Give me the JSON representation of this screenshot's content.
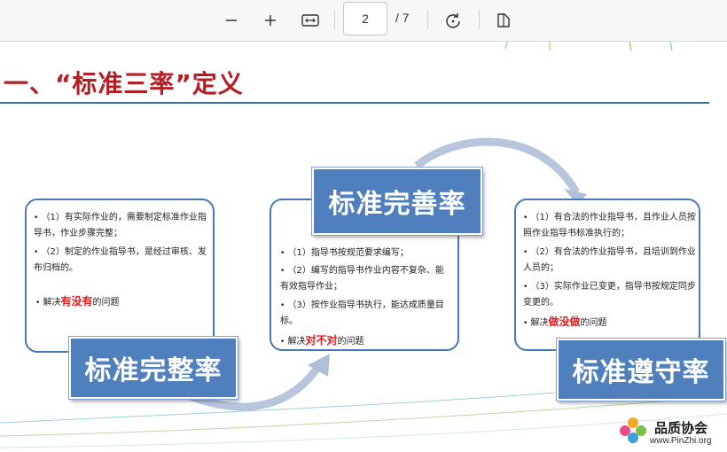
{
  "toolbar": {
    "zoom_out_icon": "minus-icon",
    "zoom_in_icon": "plus-icon",
    "fit_icon": "fit-width-icon",
    "page_current": "2",
    "page_total": "/ 7",
    "rotate_icon": "rotate-icon",
    "view_icon": "page-view-icon"
  },
  "slide": {
    "title": "一、“标准三率”定义",
    "cards": [
      {
        "label": "标准完整率",
        "bullets": [
          "（1）有实际作业的，需要制定标准作业指导书，作业步骤完整；",
          "（2）制定的作业指导书，是经过审核、发布归档的。"
        ],
        "solve_prefix": "解决",
        "solve_key": "有没有",
        "solve_suffix": "的问题"
      },
      {
        "label": "标准完善率",
        "bullets": [
          "（1）指导书按规范要求编写；",
          "（2）编写的指导书作业内容不复杂、能有效指导作业；",
          "（3）按作业指导书执行，能达成质量目标。"
        ],
        "solve_prefix": "解决",
        "solve_key": "对不对",
        "solve_suffix": "的问题"
      },
      {
        "label": "标准遵守率",
        "bullets": [
          "（1）有合法的作业指导书，且作业人员按照作业指导书标准执行的；",
          "（2）有合法的作业指导书，且培训到作业人员的；",
          "（3）实际作业已变更，指导书按规定同步变更的。"
        ],
        "solve_prefix": "解决",
        "solve_key": "做没做",
        "solve_suffix": "的问题"
      }
    ],
    "logo_text": "品质协会",
    "logo_url": "www.PinZhi.org"
  },
  "colors": {
    "title_red": "#b41e25",
    "accent_blue": "#4f7fbd",
    "key_red": "#e11b1b"
  }
}
